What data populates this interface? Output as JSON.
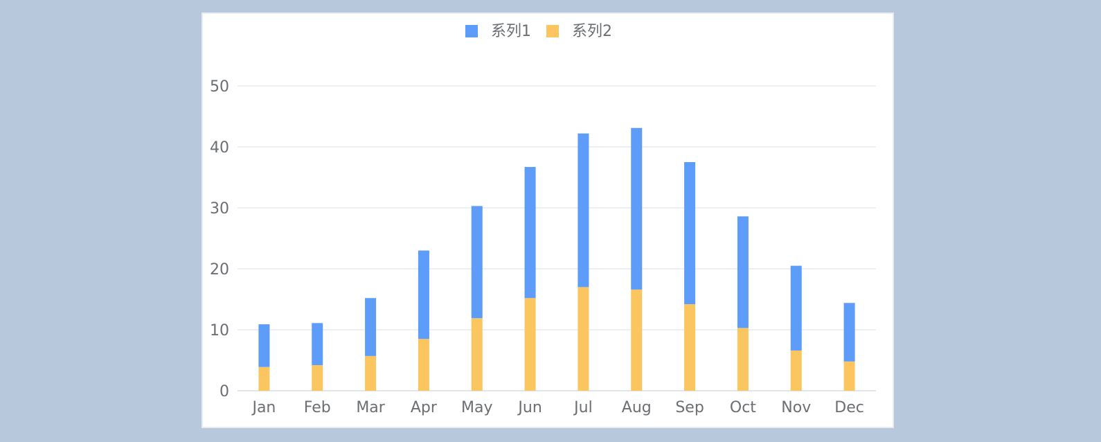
{
  "chart_data": {
    "type": "bar",
    "stacked": true,
    "categories": [
      "Jan",
      "Feb",
      "Mar",
      "Apr",
      "May",
      "Jun",
      "Jul",
      "Aug",
      "Sep",
      "Oct",
      "Nov",
      "Dec"
    ],
    "series": [
      {
        "name": "系列2",
        "color": "#fbc65f",
        "values": [
          3.9,
          4.2,
          5.7,
          8.5,
          11.9,
          15.2,
          17.0,
          16.6,
          14.2,
          10.3,
          6.6,
          4.8
        ]
      },
      {
        "name": "系列1",
        "color": "#5d9cf8",
        "values": [
          7.0,
          6.9,
          9.5,
          14.5,
          18.4,
          21.5,
          25.2,
          26.5,
          23.3,
          18.3,
          13.9,
          9.6
        ]
      }
    ],
    "legend": {
      "position": "top-center",
      "order": [
        "系列1",
        "系列2"
      ]
    },
    "ylim": [
      0,
      50
    ],
    "yticks": [
      0,
      10,
      20,
      30,
      40,
      50
    ],
    "grid": true,
    "title": "",
    "xlabel": "",
    "ylabel": ""
  }
}
